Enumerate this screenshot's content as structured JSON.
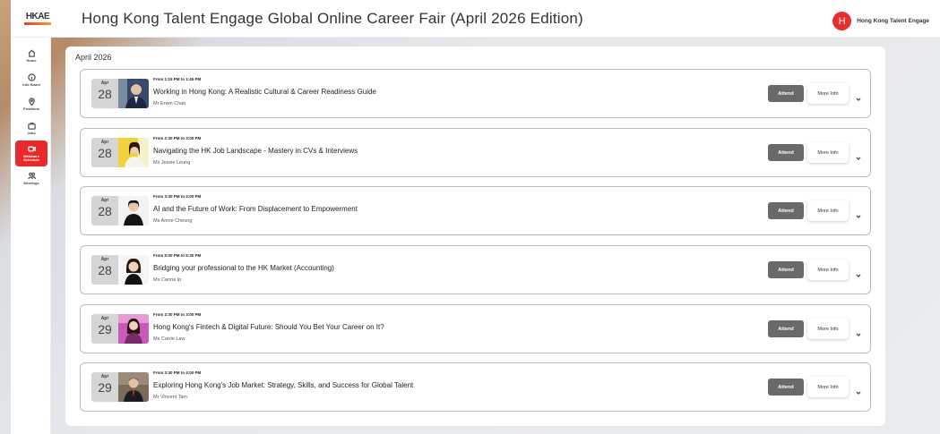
{
  "header": {
    "logo_text": "HKAE",
    "title": "Hong Kong Talent Engage Global Online Career Fair (April 2026 Edition)",
    "user_initial": "H",
    "user_name": "Hong Kong Talent Engage"
  },
  "sidebar": {
    "items": [
      {
        "label": "Home",
        "icon": "home-icon"
      },
      {
        "label": "Info Stand",
        "icon": "info-icon"
      },
      {
        "label": "Positions",
        "icon": "location-pin-icon"
      },
      {
        "label": "Jobs",
        "icon": "briefcase-icon"
      },
      {
        "label": "Webinars Schedule",
        "icon": "video-camera-icon",
        "active": true
      },
      {
        "label": "Meetings",
        "icon": "people-icon"
      }
    ]
  },
  "main": {
    "month": "April 2026",
    "attend_label": "Attend",
    "more_label": "More Info",
    "sessions": [
      {
        "month": "Apr",
        "day": "28",
        "time": "From 1:15 PM to 1:45 PM",
        "title": "Working in Hong Kong: A Realistic Cultural & Career Readiness Guide",
        "speaker": "Mr Erwin Chan"
      },
      {
        "month": "Apr",
        "day": "28",
        "time": "From 2:30 PM to 3:00 PM",
        "title": "Navigating the HK Job Landscape - Mastery in CVs & Interviews",
        "speaker": "Ms Jessie Leung"
      },
      {
        "month": "Apr",
        "day": "28",
        "time": "From 3:30 PM to 4:00 PM",
        "title": "AI and the Future of Work: From Displacement to Empowerment",
        "speaker": "Ms Annie Cheung"
      },
      {
        "month": "Apr",
        "day": "28",
        "time": "From 5:00 PM to 5:30 PM",
        "title": "Bridging your professional to the HK Market (Accounting)",
        "speaker": "Ms Carina Ip"
      },
      {
        "month": "Apr",
        "day": "29",
        "time": "From 2:30 PM to 3:00 PM",
        "title": "Hong Kong's Fintech & Digital Future: Should You Bet Your Career on It?",
        "speaker": "Ms Carrie Law"
      },
      {
        "month": "Apr",
        "day": "29",
        "time": "From 3:30 PM to 4:00 PM",
        "title": "Exploring Hong Kong's Job Market: Strategy, Skills, and Success for Global Talent",
        "speaker": "Mr Vincent Tam"
      }
    ]
  }
}
